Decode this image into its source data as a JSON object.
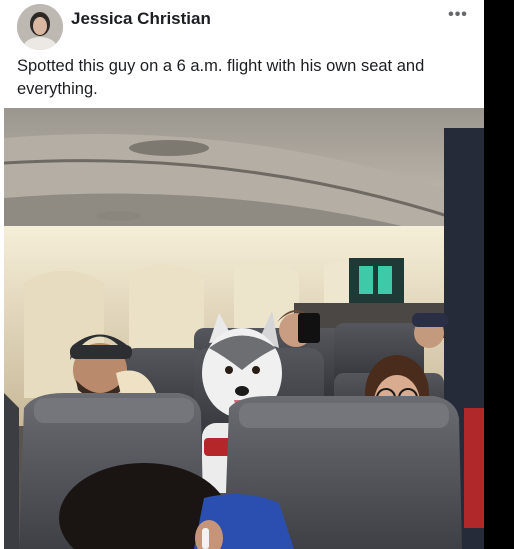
{
  "post": {
    "author_name": "Jessica Christian",
    "more_icon": "ellipsis-icon",
    "more_label": "•••",
    "text": "Spotted this guy on a 6 a.m. flight with his own seat and everything."
  },
  "colors": {
    "card_background": "#ffffff",
    "name_text": "#1c1e21",
    "muted_icon": "#65676b",
    "outer_background": "#000000"
  }
}
